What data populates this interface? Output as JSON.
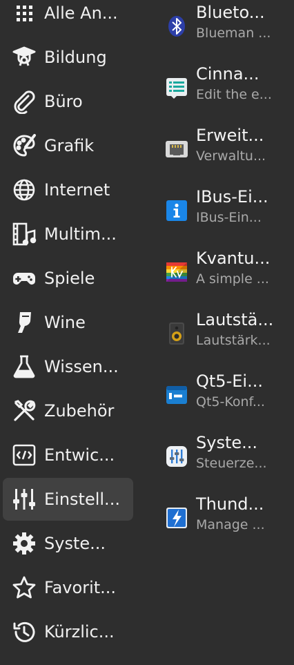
{
  "categories": [
    {
      "label": "Alle An...",
      "icon": "grid-icon"
    },
    {
      "label": "Bildung",
      "icon": "graduation-cap-icon"
    },
    {
      "label": "Büro",
      "icon": "paperclip-icon"
    },
    {
      "label": "Grafik",
      "icon": "palette-icon"
    },
    {
      "label": "Internet",
      "icon": "globe-icon"
    },
    {
      "label": "Multim...",
      "icon": "film-music-icon"
    },
    {
      "label": "Spiele",
      "icon": "gamepad-icon"
    },
    {
      "label": "Wine",
      "icon": "wine-glass-icon"
    },
    {
      "label": "Wissen...",
      "icon": "flask-icon"
    },
    {
      "label": "Zubehör",
      "icon": "tools-icon"
    },
    {
      "label": "Entwic...",
      "icon": "code-icon"
    },
    {
      "label": "Einstell...",
      "icon": "sliders-icon",
      "selected": true
    },
    {
      "label": "Syste...",
      "icon": "gear-icon"
    },
    {
      "label": "Favorit...",
      "icon": "star-icon"
    },
    {
      "label": "Kürzlic...",
      "icon": "history-icon"
    }
  ],
  "apps": [
    {
      "name": "Blueto...",
      "description": "Blueman ...",
      "icon": "bluetooth-icon"
    },
    {
      "name": "Cinna...",
      "description": "Edit the e...",
      "icon": "cinnamon-menu-editor-icon"
    },
    {
      "name": "Erweit...",
      "description": "Verwaltu...",
      "icon": "network-port-icon"
    },
    {
      "name": "IBus-Ei...",
      "description": "IBus-Ein...",
      "icon": "info-icon"
    },
    {
      "name": "Kvantu...",
      "description": "A simple ...",
      "icon": "kvantum-icon"
    },
    {
      "name": "Lautstä...",
      "description": "Lautstärk...",
      "icon": "speaker-icon"
    },
    {
      "name": "Qt5-Ei...",
      "description": "Qt5-Konf...",
      "icon": "qt5-settings-icon"
    },
    {
      "name": "Syste...",
      "description": "Steuerze...",
      "icon": "control-center-icon"
    },
    {
      "name": "Thund...",
      "description": "Manage ...",
      "icon": "thunderbolt-icon"
    }
  ],
  "colors": {
    "background": "#2e2e2e",
    "selected_background": "#414141",
    "primary_text": "#f2f2f2",
    "secondary_text": "#a9a9a9"
  }
}
